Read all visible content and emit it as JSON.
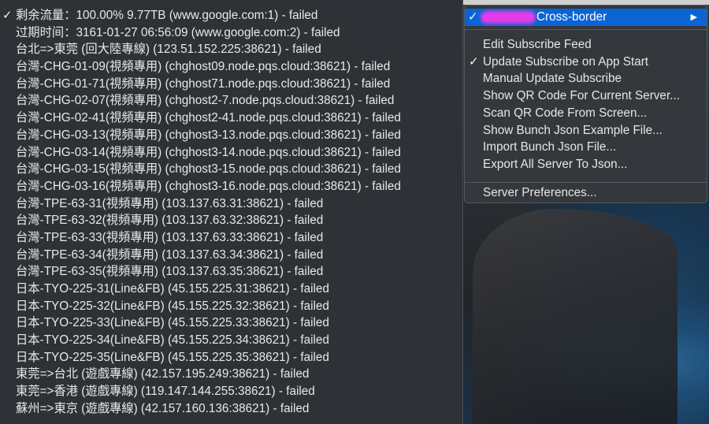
{
  "main_menu": {
    "items": [
      {
        "checked": true,
        "text": "剩余流量：100.00% 9.77TB (www.google.com:1)  - failed"
      },
      {
        "checked": false,
        "text": "过期时间：3161-01-27 06:56:09 (www.google.com:2)  - failed"
      },
      {
        "checked": false,
        "text": "台北=>東莞 (回大陸專線) (123.51.152.225:38621)  - failed"
      },
      {
        "checked": false,
        "text": "台灣-CHG-01-09(視頻專用) (chghost09.node.pqs.cloud:38621)  - failed"
      },
      {
        "checked": false,
        "text": "台灣-CHG-01-71(視頻專用) (chghost71.node.pqs.cloud:38621)  - failed"
      },
      {
        "checked": false,
        "text": "台灣-CHG-02-07(視頻專用) (chghost2-7.node.pqs.cloud:38621)  - failed"
      },
      {
        "checked": false,
        "text": "台灣-CHG-02-41(視頻專用) (chghost2-41.node.pqs.cloud:38621)  - failed"
      },
      {
        "checked": false,
        "text": "台灣-CHG-03-13(視頻專用) (chghost3-13.node.pqs.cloud:38621)  - failed"
      },
      {
        "checked": false,
        "text": "台灣-CHG-03-14(視頻專用) (chghost3-14.node.pqs.cloud:38621)  - failed"
      },
      {
        "checked": false,
        "text": "台灣-CHG-03-15(視頻專用) (chghost3-15.node.pqs.cloud:38621)  - failed"
      },
      {
        "checked": false,
        "text": "台灣-CHG-03-16(視頻專用) (chghost3-16.node.pqs.cloud:38621)  - failed"
      },
      {
        "checked": false,
        "text": "台灣-TPE-63-31(視頻專用) (103.137.63.31:38621)  - failed"
      },
      {
        "checked": false,
        "text": "台灣-TPE-63-32(視頻專用) (103.137.63.32:38621)  - failed"
      },
      {
        "checked": false,
        "text": "台灣-TPE-63-33(視頻專用) (103.137.63.33:38621)  - failed"
      },
      {
        "checked": false,
        "text": "台灣-TPE-63-34(視頻專用) (103.137.63.34:38621)  - failed"
      },
      {
        "checked": false,
        "text": "台灣-TPE-63-35(視頻專用) (103.137.63.35:38621)  - failed"
      },
      {
        "checked": false,
        "text": "日本-TYO-225-31(Line&FB) (45.155.225.31:38621)  - failed"
      },
      {
        "checked": false,
        "text": "日本-TYO-225-32(Line&FB) (45.155.225.32:38621)  - failed"
      },
      {
        "checked": false,
        "text": "日本-TYO-225-33(Line&FB) (45.155.225.33:38621)  - failed"
      },
      {
        "checked": false,
        "text": "日本-TYO-225-34(Line&FB) (45.155.225.34:38621)  - failed"
      },
      {
        "checked": false,
        "text": "日本-TYO-225-35(Line&FB) (45.155.225.35:38621)  - failed"
      },
      {
        "checked": false,
        "text": "東莞=>台北 (遊戲專線) (42.157.195.249:38621)  - failed"
      },
      {
        "checked": false,
        "text": "東莞=>香港 (遊戲專線) (119.147.144.255:38621)  - failed"
      },
      {
        "checked": false,
        "text": "蘇州=>東京 (遊戲專線) (42.157.160.136:38621)  - failed"
      }
    ]
  },
  "submenu": {
    "header": {
      "checked": true,
      "label": "Cross-border"
    },
    "group1": [
      {
        "checked": false,
        "label": "Edit Subscribe Feed"
      },
      {
        "checked": true,
        "label": "Update Subscribe on App Start"
      },
      {
        "checked": false,
        "label": "Manual Update Subscribe"
      },
      {
        "checked": false,
        "label": "Show QR Code For Current Server..."
      },
      {
        "checked": false,
        "label": "Scan QR Code From Screen..."
      },
      {
        "checked": false,
        "label": "Show Bunch Json Example File..."
      },
      {
        "checked": false,
        "label": "Import Bunch Json File..."
      },
      {
        "checked": false,
        "label": "Export All Server To Json..."
      }
    ],
    "group2": [
      {
        "checked": false,
        "label": "Server Preferences..."
      }
    ]
  },
  "colors": {
    "highlight": "#0a64d6",
    "redaction": "#e63be6"
  }
}
